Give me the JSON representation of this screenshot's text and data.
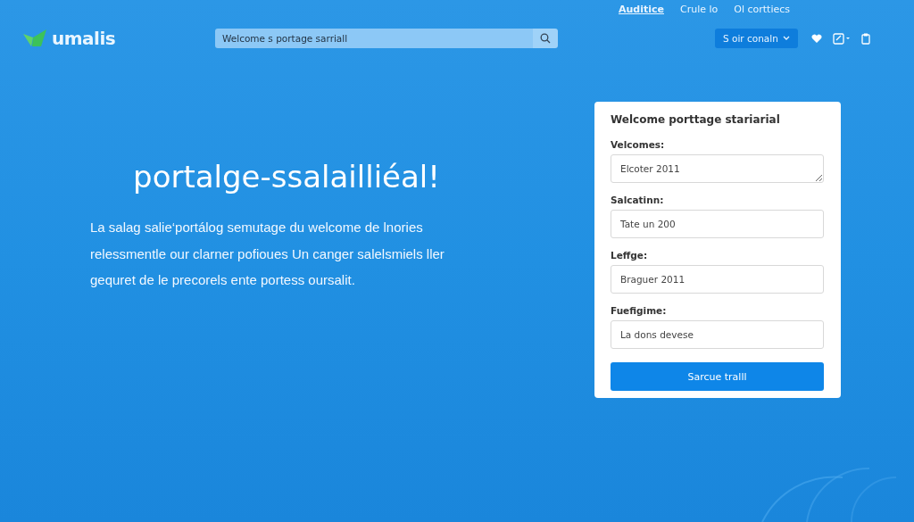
{
  "top_links": [
    {
      "label": "Auditice",
      "selected": true
    },
    {
      "label": "Crule lo",
      "selected": false
    },
    {
      "label": "Ol corttiecs",
      "selected": false
    }
  ],
  "header": {
    "logo": "umalis",
    "search": {
      "value": "Welcome s portage sarriall"
    },
    "account_button": "S oir conaln"
  },
  "hero": {
    "title": "portalge-ssalailliéal!",
    "text": "La salag salie‘portálog semutage du welcome de lnories relessmentle our clarner pofioues Un canger salelsmiels ller gequret de le precorels ente portess oursalit."
  },
  "form": {
    "title": "Welcome porttage stariarial",
    "fields": [
      {
        "label": "Velcomes:",
        "value": "Elcoter 2011",
        "kind": "textarea"
      },
      {
        "label": "Salcatinn:",
        "value": "Tate un 200",
        "kind": "input"
      },
      {
        "label": "Leffge:",
        "value": "Braguer 2011",
        "kind": "input"
      },
      {
        "label": "Fuefigime:",
        "value": "La dons devese",
        "kind": "input"
      }
    ],
    "submit": "Sarcue tralll"
  }
}
